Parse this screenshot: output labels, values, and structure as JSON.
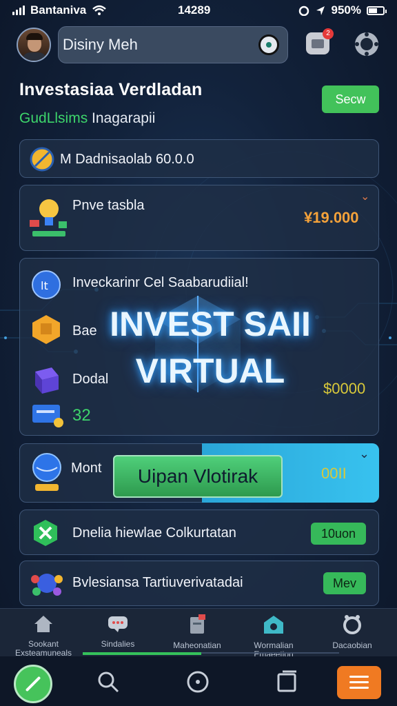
{
  "status_bar": {
    "carrier": "Bantaniva",
    "time": "14289",
    "battery": "950%"
  },
  "header": {
    "search_text": "Disiny Meh",
    "notification_count": "2"
  },
  "page": {
    "title": "Investasiaa Verdladan",
    "subtitle_green": "GudLlsims",
    "subtitle_white": "Inagarapii",
    "show_button": "Secw"
  },
  "balance_row": {
    "label": "M Dadnisaolab 60.0.0"
  },
  "private_row": {
    "label": "Pnve tasbla",
    "value": "¥19.000"
  },
  "group_card": {
    "row1": "Inveckarinr Cel  Saabarudiial!",
    "row2": "Bae",
    "row3": "Dodal",
    "row4_value": "32",
    "value": "$0000",
    "overlay_line1": "INVEST SAII",
    "overlay_line2": "VIRTUAL"
  },
  "upgrade_row": {
    "label": "Mont",
    "button": "Uipan Vlotirak",
    "value": "00II"
  },
  "online_row": {
    "label": "Dnelia hiewlae Colkurtatan",
    "button": "10uon"
  },
  "extra_row": {
    "label": "Bvlesiansa Tartiuverivatadai",
    "button": "Mev"
  },
  "tabs": [
    {
      "label": "Sookant Exsteamuneals"
    },
    {
      "label": "Sindalies"
    },
    {
      "label": "Maheonatian"
    },
    {
      "label": "Wormalian Emaeetion"
    },
    {
      "label": "Dacaobian"
    }
  ],
  "colors": {
    "accent_green": "#42c25a",
    "accent_orange": "#f07a22",
    "value_orange": "#f4a23a",
    "value_yellow": "#d9c93a"
  }
}
